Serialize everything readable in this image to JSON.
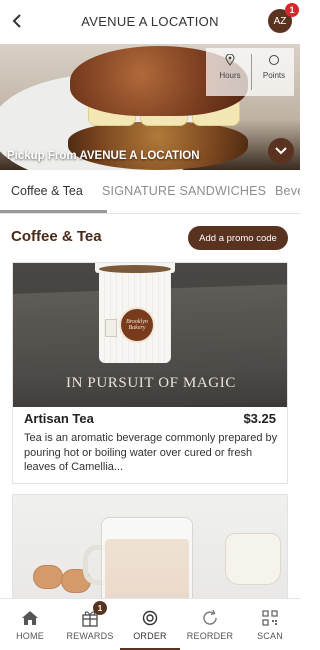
{
  "header": {
    "title": "AVENUE A LOCATION",
    "avatar_initials": "AZ",
    "avatar_badge": "1"
  },
  "hero": {
    "caption": "Pickup From AVENUE A LOCATION",
    "tools": [
      {
        "label": "Hours",
        "icon": "location-pin-icon"
      },
      {
        "label": "Points",
        "icon": "points-icon"
      }
    ]
  },
  "tabs": [
    {
      "label": "Coffee & Tea",
      "active": true
    },
    {
      "label": "SIGNATURE SANDWICHES",
      "active": false
    },
    {
      "label": "Beve",
      "active": false
    }
  ],
  "section": {
    "title": "Coffee & Tea",
    "promo_button": "Add a promo code"
  },
  "products": [
    {
      "photo_text": "IN PURSUIT OF MAGIC",
      "cup_logo_text": "Brooklyn Bakery",
      "name": "Artisan Tea",
      "price": "$3.25",
      "description": "Tea is an aromatic beverage commonly prepared by pouring hot or boiling water over cured or fresh leaves of Camellia..."
    },
    {
      "name": "",
      "price": "",
      "description": ""
    }
  ],
  "bottom_nav": [
    {
      "label": "HOME",
      "icon": "home-icon",
      "active": false
    },
    {
      "label": "REWARDS",
      "icon": "gift-icon",
      "active": false,
      "badge": "1"
    },
    {
      "label": "ORDER",
      "icon": "order-icon",
      "active": true
    },
    {
      "label": "REORDER",
      "icon": "refresh-icon",
      "active": false
    },
    {
      "label": "SCAN",
      "icon": "qr-scan-icon",
      "active": false
    }
  ],
  "colors": {
    "brand_brown": "#5a3220",
    "badge_red": "#d9262e",
    "title_brown": "#4a2a18"
  }
}
